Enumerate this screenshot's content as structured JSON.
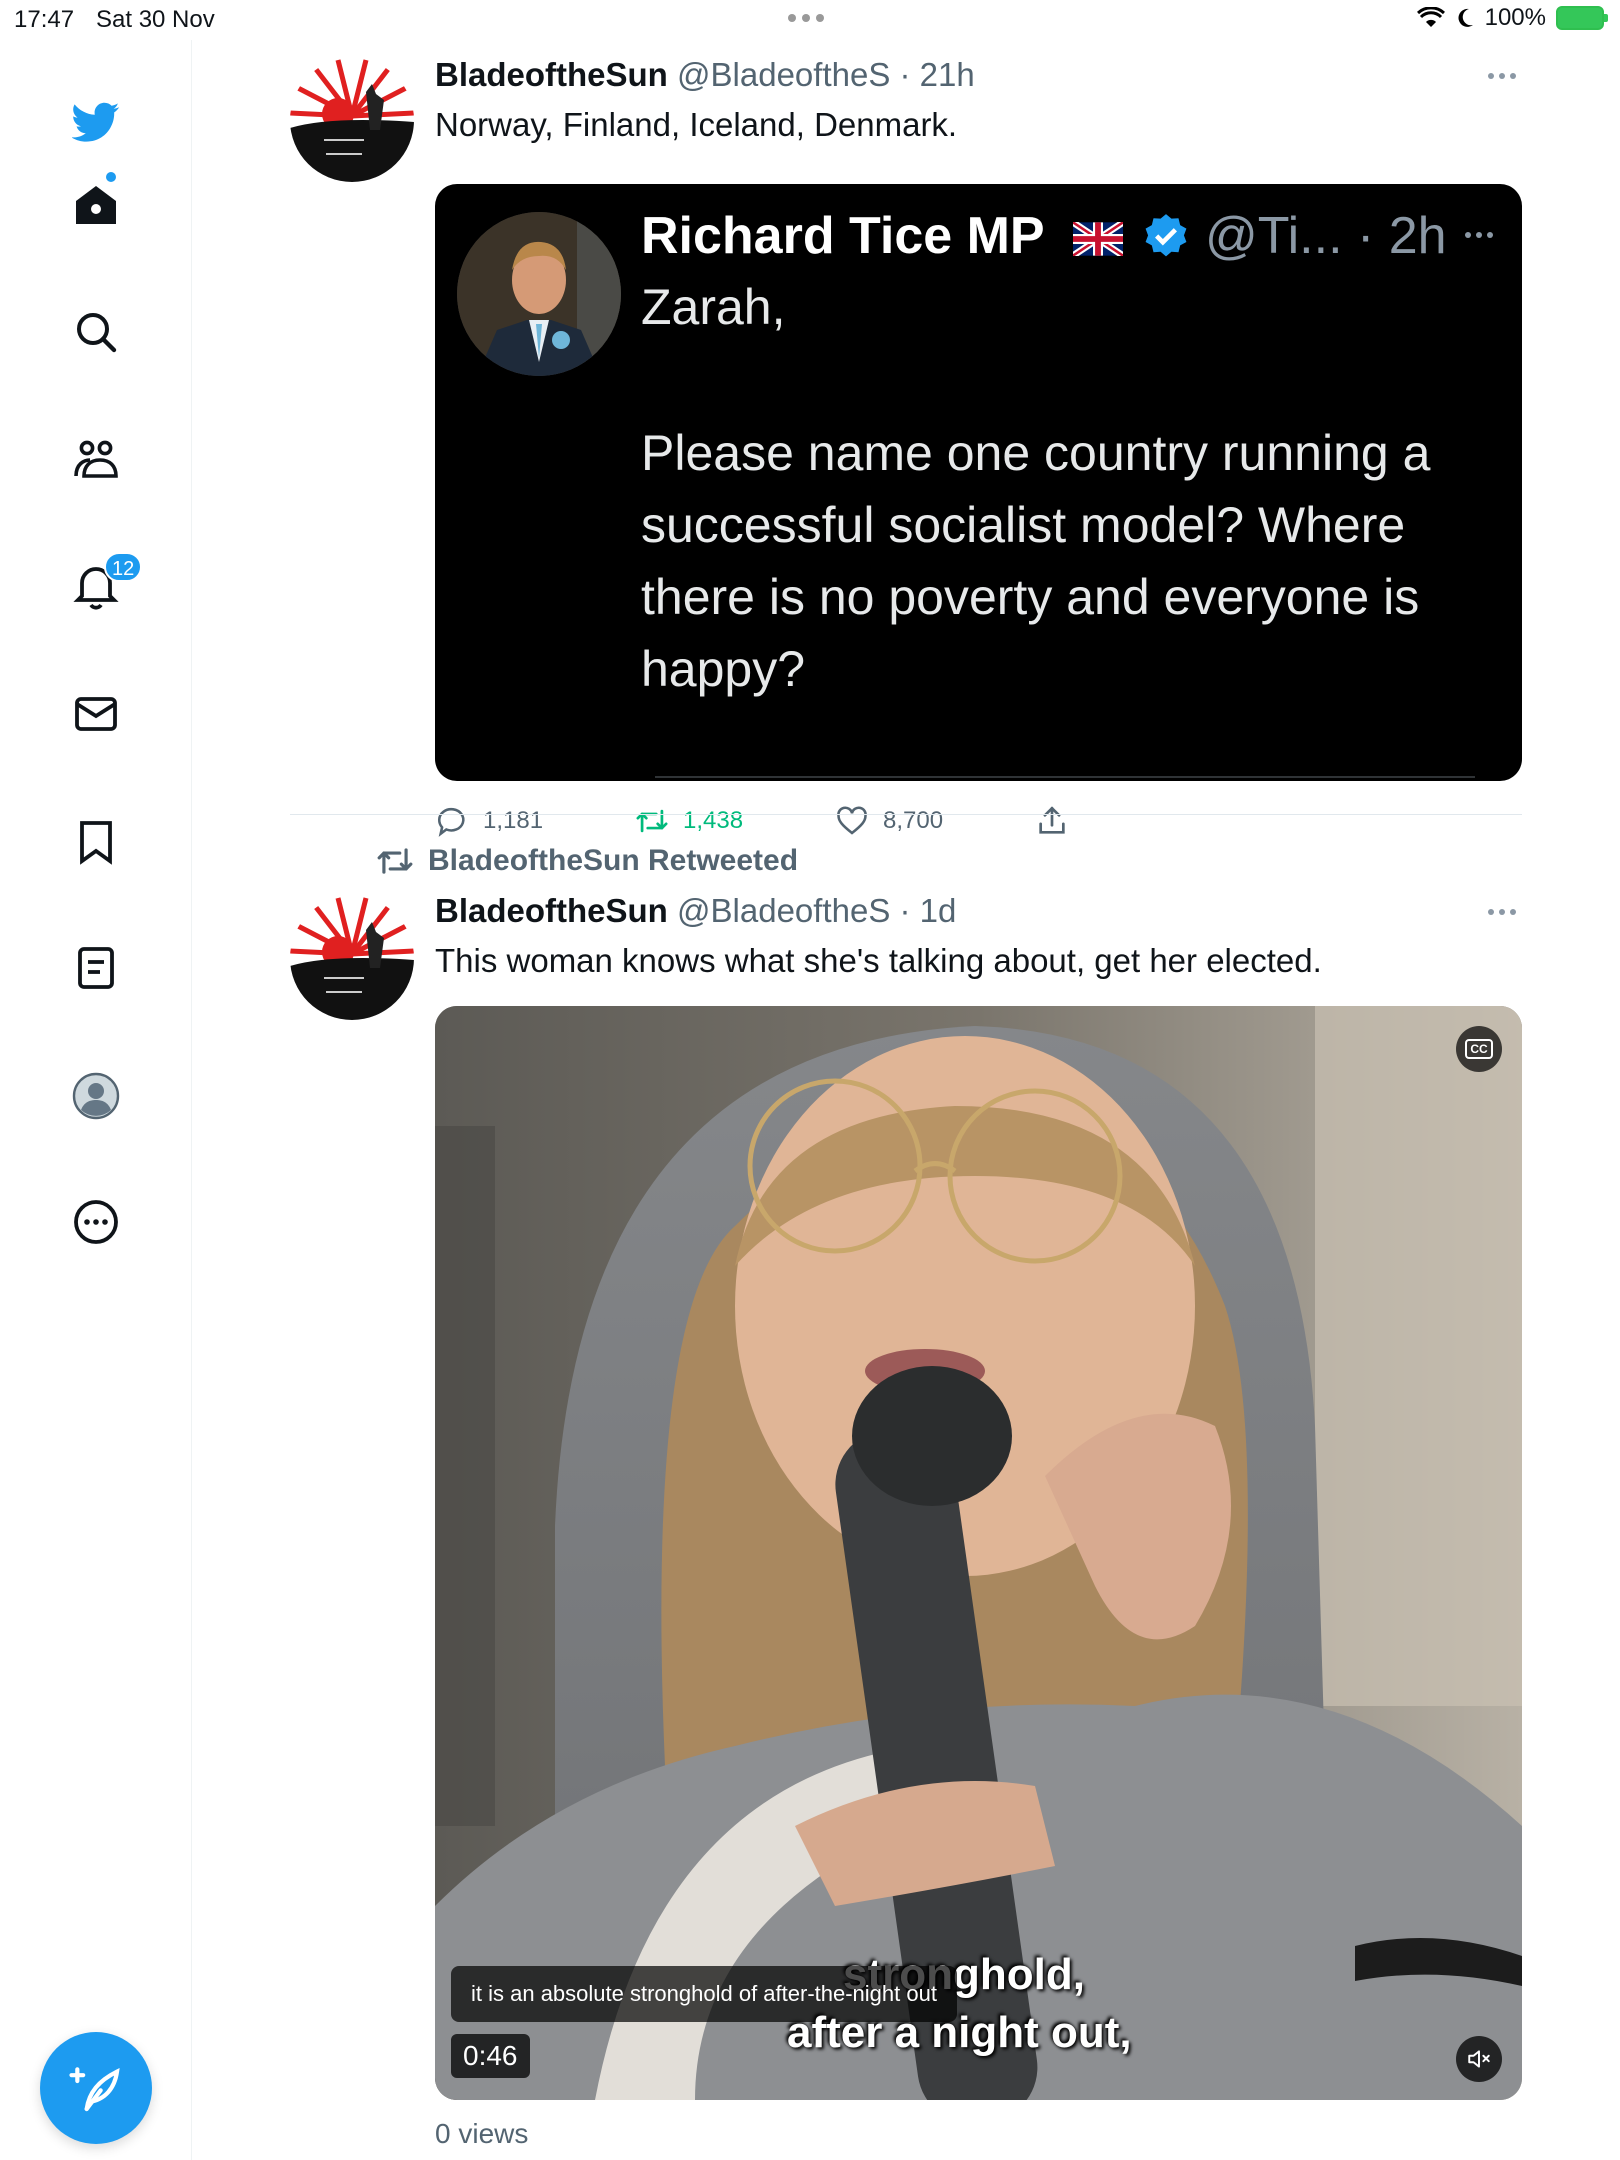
{
  "status_bar": {
    "time": "17:47",
    "date": "Sat 30 Nov",
    "battery": "100%"
  },
  "sidebar": {
    "items": [
      {
        "icon": "twitter-logo-icon"
      },
      {
        "icon": "home-icon"
      },
      {
        "icon": "search-icon"
      },
      {
        "icon": "communities-icon"
      },
      {
        "icon": "notifications-icon",
        "badge": "12"
      },
      {
        "icon": "messages-icon"
      },
      {
        "icon": "bookmarks-icon"
      },
      {
        "icon": "lists-icon"
      },
      {
        "icon": "profile-icon"
      },
      {
        "icon": "more-icon"
      }
    ],
    "compose_icon": "compose-tweet-icon"
  },
  "tweets": [
    {
      "name": "BladeoftheSun",
      "handle": "@BladeoftheS",
      "time": "· 21h",
      "text": "Norway, Finland, Iceland, Denmark.",
      "quote": {
        "name": "Richard Tice MP",
        "handle": "@Ti... · 2h",
        "lines": [
          "Zarah,",
          "Please name one country running a",
          "successful socialist model? Where",
          "there is no poverty and everyone is",
          "happy?"
        ]
      },
      "replies": "1,181",
      "retweets": "1,438",
      "likes": "8,700"
    },
    {
      "retweet_label": "BladeoftheSun Retweeted",
      "name": "BladeoftheSun",
      "handle": "@BladeoftheS",
      "time": "· 1d",
      "text": "This woman knows what she's talking about, get her elected.",
      "video": {
        "caption": "it is an absolute stronghold of after-the-night out",
        "burned_line1": "stronghold,",
        "burned_line2": "after a night out,",
        "duration": "0:46",
        "cc": "CC"
      },
      "views": "0 views"
    }
  ],
  "colors": {
    "accent": "#1d9bf0",
    "retweet": "#00ba7c",
    "secondary_text": "#536471"
  }
}
